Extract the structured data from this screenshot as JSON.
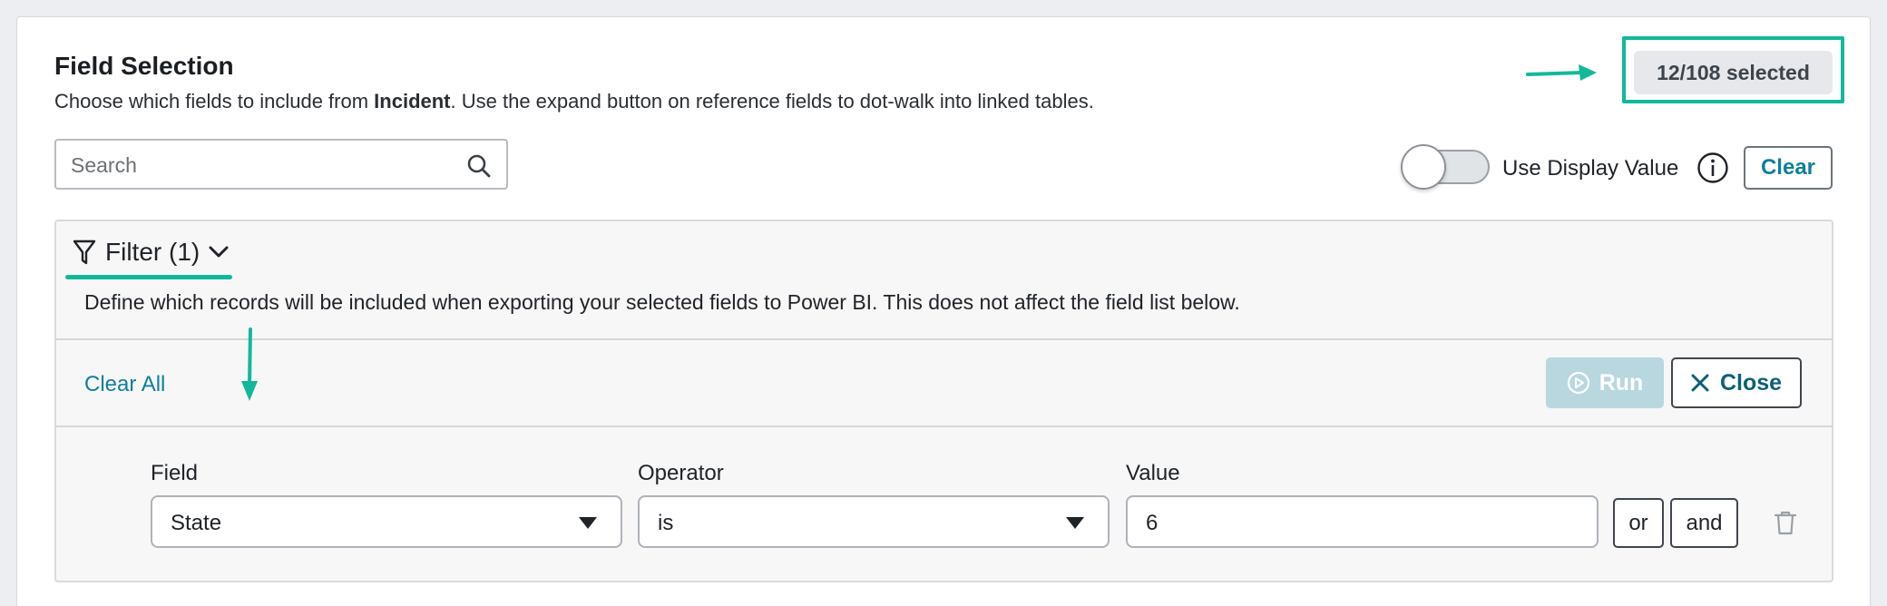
{
  "header": {
    "title": "Field Selection",
    "subtitle_prefix": "Choose which fields to include from ",
    "subtitle_table": "Incident",
    "subtitle_suffix": ". Use the expand button on reference fields to dot-walk into linked tables.",
    "selected_count": "12/108 selected"
  },
  "search": {
    "placeholder": "Search",
    "value": "",
    "icon": "search-icon"
  },
  "display_value": {
    "label": "Use Display Value",
    "enabled": false,
    "info_icon": "info-icon"
  },
  "toolbar": {
    "clear_label": "Clear"
  },
  "filter": {
    "label": "Filter (1)",
    "icon": "funnel-icon",
    "expand_icon": "chevron-down-icon",
    "description": "Define which records will be included when exporting your selected fields to Power BI. This does not affect the field list below.",
    "clear_all_label": "Clear All",
    "run_label": "Run",
    "close_label": "Close",
    "condition": {
      "field_label": "Field",
      "field_value": "State",
      "operator_label": "Operator",
      "operator_value": "is",
      "value_label": "Value",
      "value": "6",
      "or_label": "or",
      "and_label": "and"
    }
  },
  "colors": {
    "accent_callout": "#13b89a",
    "link": "#0f7f9e",
    "run_disabled": "#b9d7df",
    "badge_bg": "#e6e8eb"
  }
}
